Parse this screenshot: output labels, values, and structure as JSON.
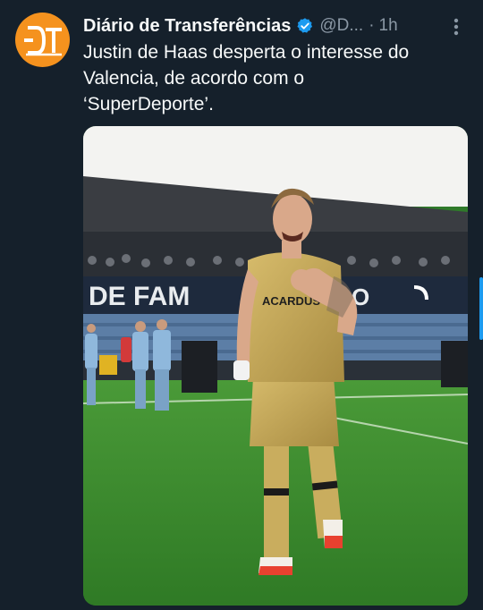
{
  "tweet": {
    "display_name": "Diário de Transferências",
    "handle": "@D...",
    "separator": "·",
    "time": "1h",
    "text_lines": [
      "Justin de Haas desperta o interesse do",
      "Valencia, de acordo com o",
      "‘SuperDeporte’."
    ],
    "verified_icon": "verified-badge-icon",
    "more_icon": "more-vertical-icon",
    "avatar_logo_text": "DT"
  },
  "media": {
    "banner_text": "DE FAM",
    "shirt_text": "ACARDUS",
    "colors": {
      "grass": "#3d8b2f",
      "kit": "#c9ad5e",
      "away_kit": "#8fb8dc",
      "stand": "#33383f",
      "sky": "#f2f2f0"
    }
  },
  "colors": {
    "background": "#15202b",
    "text": "#f7f9f9",
    "secondary_text": "#8b98a5",
    "verified": "#1d9bf0",
    "avatar": "#f5921e"
  }
}
